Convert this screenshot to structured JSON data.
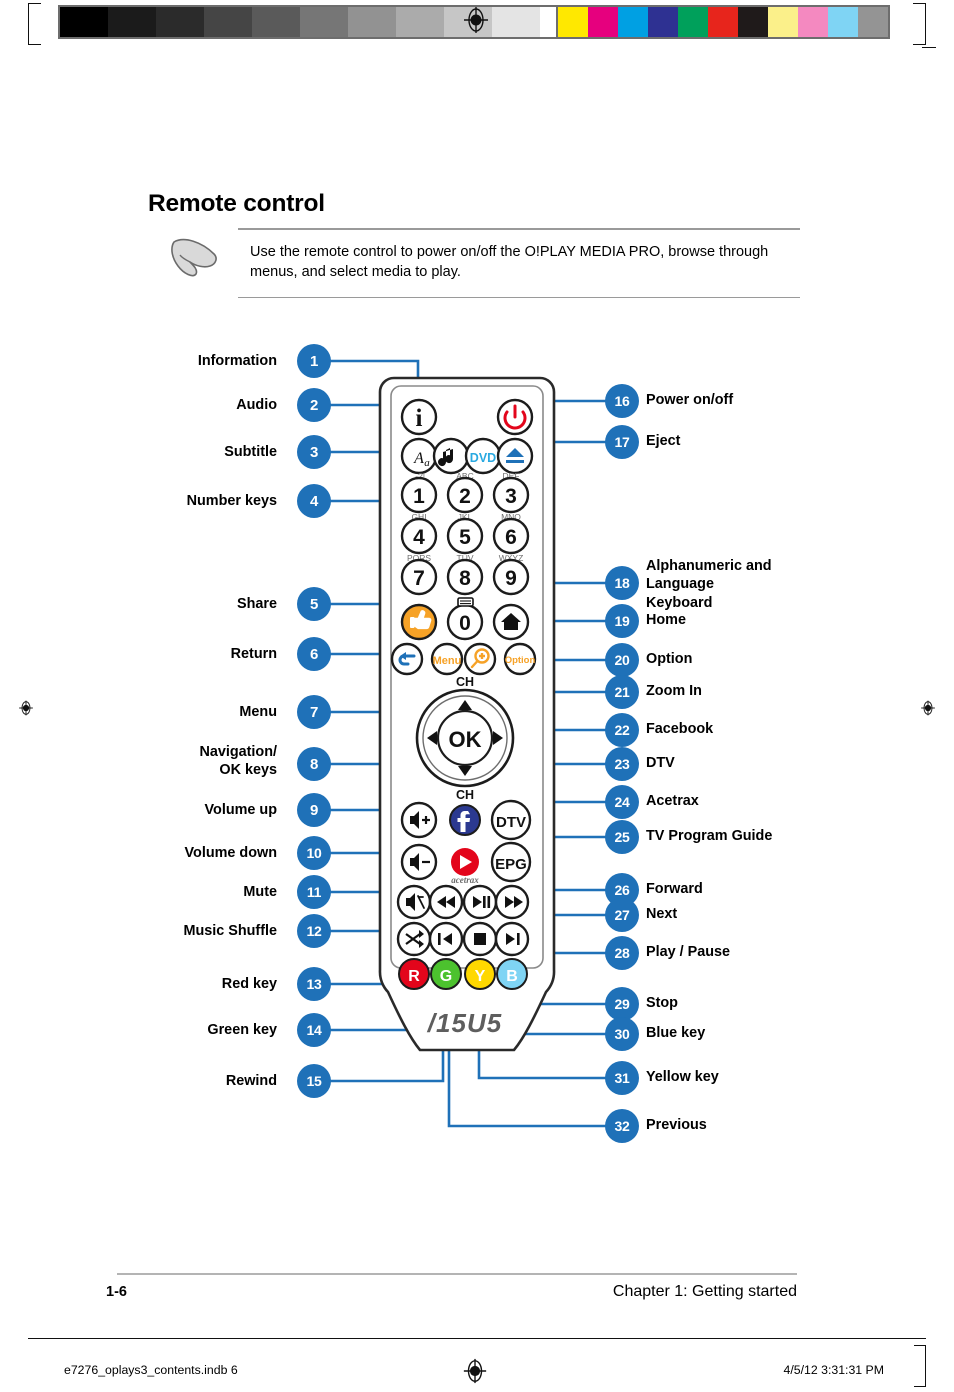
{
  "document": {
    "heading": "Remote control",
    "note": "Use the remote control to power on/off the O!PLAY MEDIA PRO, browse through menus, and select media to play.",
    "footer_page": "1-6",
    "footer_chapter": "Chapter 1:  Getting started",
    "signature_file": "e7276_oplays3_contents.indb   6",
    "signature_date": "4/5/12   3:31:31 PM"
  },
  "colors": {
    "badge_blue": "#1f71b8",
    "wire_blue": "#1f71b8",
    "accent_orange": "#f6a227",
    "power_red": "#e3051b",
    "facebook_blue": "#2b3990",
    "dvd_blue": "#29a9e1"
  },
  "calibration": {
    "gray_bar": [
      "#000000",
      "#1b1b1b",
      "#2b2b2b",
      "#454545",
      "#5a5a5a",
      "#767676",
      "#929292",
      "#ababab",
      "#c6c6c6",
      "#e4e4e4",
      "#ffffff"
    ],
    "color_bar": [
      "#ffe800",
      "#e6007e",
      "#00a0e3",
      "#2e3192",
      "#00a05b",
      "#e7251c",
      "#1f1a1a",
      "#fbf08a",
      "#f489c0",
      "#7fd4f4",
      "#949494"
    ]
  },
  "callouts_left": [
    {
      "n": "1",
      "label": "Information"
    },
    {
      "n": "2",
      "label": "Audio"
    },
    {
      "n": "3",
      "label": "Subtitle"
    },
    {
      "n": "4",
      "label": "Number keys"
    },
    {
      "n": "5",
      "label": "Share"
    },
    {
      "n": "6",
      "label": "Return"
    },
    {
      "n": "7",
      "label": "Menu"
    },
    {
      "n": "8",
      "label": "Navigation/ OK keys"
    },
    {
      "n": "9",
      "label": "Volume up"
    },
    {
      "n": "10",
      "label": "Volume down"
    },
    {
      "n": "11",
      "label": "Mute"
    },
    {
      "n": "12",
      "label": "Music Shuffle"
    },
    {
      "n": "13",
      "label": "Red key"
    },
    {
      "n": "14",
      "label": "Green key"
    },
    {
      "n": "15",
      "label": "Rewind"
    }
  ],
  "callouts_right": [
    {
      "n": "16",
      "label": "Power on/off"
    },
    {
      "n": "17",
      "label": "Eject"
    },
    {
      "n": "18",
      "label": "Alphanumeric and Language Keyboard"
    },
    {
      "n": "19",
      "label": "Home"
    },
    {
      "n": "20",
      "label": "Option"
    },
    {
      "n": "21",
      "label": "Zoom In"
    },
    {
      "n": "22",
      "label": "Facebook"
    },
    {
      "n": "23",
      "label": "DTV"
    },
    {
      "n": "24",
      "label": "Acetrax"
    },
    {
      "n": "25",
      "label": "TV Program Guide"
    },
    {
      "n": "26",
      "label": "Forward"
    },
    {
      "n": "27",
      "label": "Next"
    },
    {
      "n": "28",
      "label": "Play / Pause"
    },
    {
      "n": "29",
      "label": "Stop"
    },
    {
      "n": "30",
      "label": "Blue key"
    },
    {
      "n": "31",
      "label": "Yellow key"
    },
    {
      "n": "32",
      "label": "Previous"
    }
  ],
  "remote": {
    "brand": "ASUS",
    "keypad": [
      {
        "digit": "1",
        "letters": ".-?!"
      },
      {
        "digit": "2",
        "letters": "ABC"
      },
      {
        "digit": "3",
        "letters": "DEF"
      },
      {
        "digit": "4",
        "letters": "GHI"
      },
      {
        "digit": "5",
        "letters": "JKL"
      },
      {
        "digit": "6",
        "letters": "MNO"
      },
      {
        "digit": "7",
        "letters": "PQRS"
      },
      {
        "digit": "8",
        "letters": "TUV"
      },
      {
        "digit": "9",
        "letters": "WXYZ"
      },
      {
        "digit": "0",
        "letters": ""
      }
    ],
    "buttons": {
      "dvd": "DVD",
      "menu": "Menu",
      "option": "Option",
      "ok": "OK",
      "ch_up": "CH",
      "ch_down": "CH",
      "dtv": "DTV",
      "epg": "EPG",
      "acetrax": "acetrax",
      "color_red": "R",
      "color_green": "G",
      "color_yellow": "Y",
      "color_blue": "B"
    }
  }
}
